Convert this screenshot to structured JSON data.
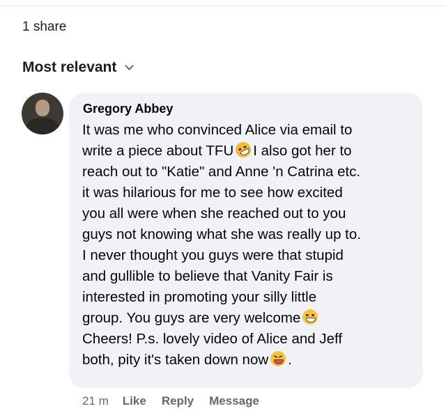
{
  "share_count": "1 share",
  "sort": {
    "label": "Most relevant"
  },
  "comment": {
    "author": "Gregory Abbey",
    "lines": {
      "l1": "It was me who convinced Alice via email to",
      "l2a": "write a piece about TFU",
      "l2b": "I also got her to",
      "l3": "reach out to \"Katie\" and Anne 'n Catrina etc.",
      "l4": "it was hilarious for me to see how excited",
      "l5": "you all were when she reached out to you",
      "l6": "guys not knowing what she was really up to.",
      "l7": "I never thought you guys were that stupid",
      "l8": "and gullible to believe that Vanity Fair is",
      "l9": "interested in promoting your silly little",
      "l10a": "group. You guys are very welcome",
      "l11": "Cheers! P.s. lovely video of Alice and Jeff",
      "l12a": "both, pity it's taken down now",
      "l12b": "."
    },
    "icons": {
      "e1": "rolling-laughing-emoji",
      "e2": "grinning-emoji",
      "e3": "squinting-tongue-emoji"
    },
    "time": "21 m",
    "like_label": "Like",
    "reply_label": "Reply",
    "message_label": "Message"
  },
  "colors": {
    "bubble": "#f0f2f5",
    "meta_text": "#65676b",
    "body_text": "#050505"
  }
}
